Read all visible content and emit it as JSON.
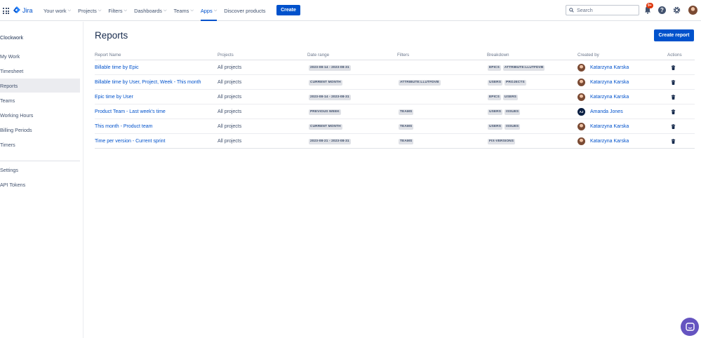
{
  "nav": {
    "logo": "Jira",
    "items": [
      {
        "label": "Your work",
        "chevron": true
      },
      {
        "label": "Projects",
        "chevron": true
      },
      {
        "label": "Filters",
        "chevron": true
      },
      {
        "label": "Dashboards",
        "chevron": true
      },
      {
        "label": "Teams",
        "chevron": true
      },
      {
        "label": "Apps",
        "chevron": true,
        "active": true
      },
      {
        "label": "Discover products",
        "chevron": false
      }
    ],
    "create_label": "Create",
    "search_placeholder": "Search",
    "notifications_badge": "9+",
    "help_label": "?"
  },
  "sidebar": {
    "app_name": "Clockwork",
    "items": [
      {
        "label": "My Work"
      },
      {
        "label": "Timesheet"
      },
      {
        "label": "Reports",
        "selected": true
      },
      {
        "label": "Teams"
      },
      {
        "label": "Working Hours"
      },
      {
        "label": "Billing Periods"
      },
      {
        "label": "Timers"
      }
    ],
    "bottom_items": [
      {
        "label": "Settings"
      },
      {
        "label": "API Tokens"
      }
    ]
  },
  "main": {
    "title": "Reports",
    "create_report_label": "Create report",
    "columns": [
      "Report Name",
      "Projects",
      "Date range",
      "Filters",
      "Breakdown",
      "Created by",
      "Actions"
    ],
    "rows": [
      {
        "name": "Billable time by Epic",
        "projects": "All projects",
        "date_range": "2023-08-14 - 2023-08-31",
        "filters": [],
        "breakdown": [
          "EPICS",
          "ATTRIBUTE:LLUTFDVB"
        ],
        "creator": "Katarzyna Karska",
        "avatar": "photo"
      },
      {
        "name": "Billable time by User, Project, Week - This month",
        "projects": "All projects",
        "date_range": "CURRENT MONTH",
        "filters": [
          "ATTRIBUTE:LLUTFDVB"
        ],
        "breakdown": [
          "USERS",
          "PROJECTS"
        ],
        "creator": "Katarzyna Karska",
        "avatar": "photo"
      },
      {
        "name": "Epic time by User",
        "projects": "All projects",
        "date_range": "2023-08-14 - 2023-08-31",
        "filters": [],
        "breakdown": [
          "EPICS",
          "USERS"
        ],
        "creator": "Katarzyna Karska",
        "avatar": "photo"
      },
      {
        "name": "Product Team - Last week's time",
        "projects": "All projects",
        "date_range": "PREVIOUS WEEK",
        "filters": [
          "TEAMS"
        ],
        "breakdown": [
          "USERS",
          "ISSUES"
        ],
        "creator": "Amanda Jones",
        "avatar": "AJ"
      },
      {
        "name": "This month - Product team",
        "projects": "All projects",
        "date_range": "CURRENT MONTH",
        "filters": [
          "TEAMS"
        ],
        "breakdown": [
          "USERS",
          "ISSUES"
        ],
        "creator": "Katarzyna Karska",
        "avatar": "photo"
      },
      {
        "name": "Time per version - Current sprint",
        "projects": "All projects",
        "date_range": "2023-08-21 - 2023-08-31",
        "filters": [
          "TEAMS"
        ],
        "breakdown": [
          "FIX-VERSIONS"
        ],
        "creator": "Katarzyna Karska",
        "avatar": "photo"
      }
    ]
  },
  "colors": {
    "brand": "#0052cc",
    "badge": "#de350b",
    "chat": "#6554c0"
  },
  "icons": [
    "app-switcher-icon",
    "jira-logo-icon",
    "search-icon",
    "bell-icon",
    "help-icon",
    "gear-icon",
    "trash-icon",
    "chat-icon"
  ]
}
